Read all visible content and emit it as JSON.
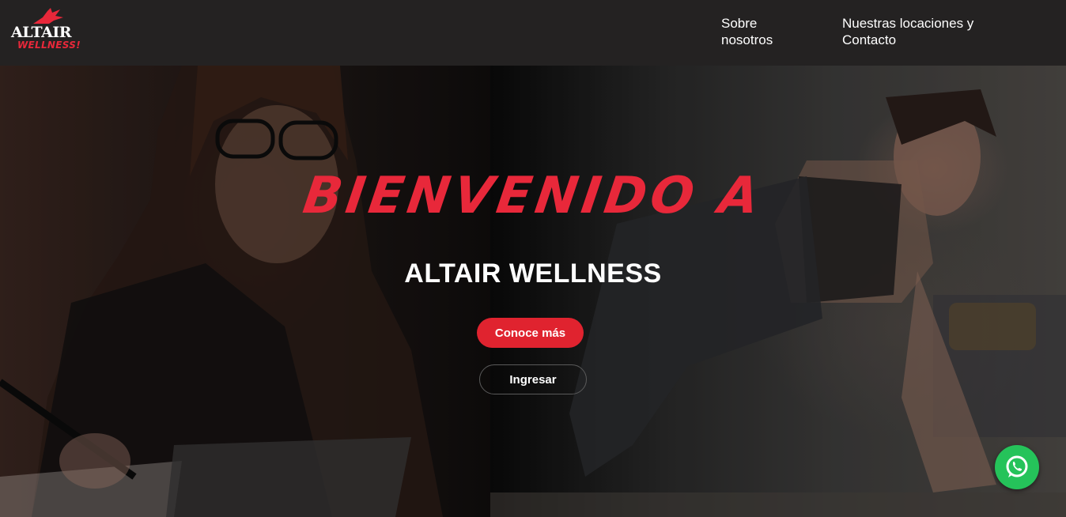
{
  "header": {
    "logo": {
      "brand": "ALTAIR",
      "tagline": "WELLNESS!"
    },
    "nav": [
      {
        "label": "Sobre\nnosotros"
      },
      {
        "label": "Nuestras locaciones y\nContacto"
      }
    ]
  },
  "hero": {
    "title": "BIENVENIDO A",
    "brand": "ALTAIR WELLNESS",
    "primary_button": "Conoce más",
    "secondary_button": "Ingresar"
  },
  "colors": {
    "accent": "#e0232f",
    "header_bg": "#242222",
    "whatsapp": "#25c35a"
  },
  "icons": {
    "logo": "altair-bird-icon",
    "floating": "whatsapp-icon"
  }
}
